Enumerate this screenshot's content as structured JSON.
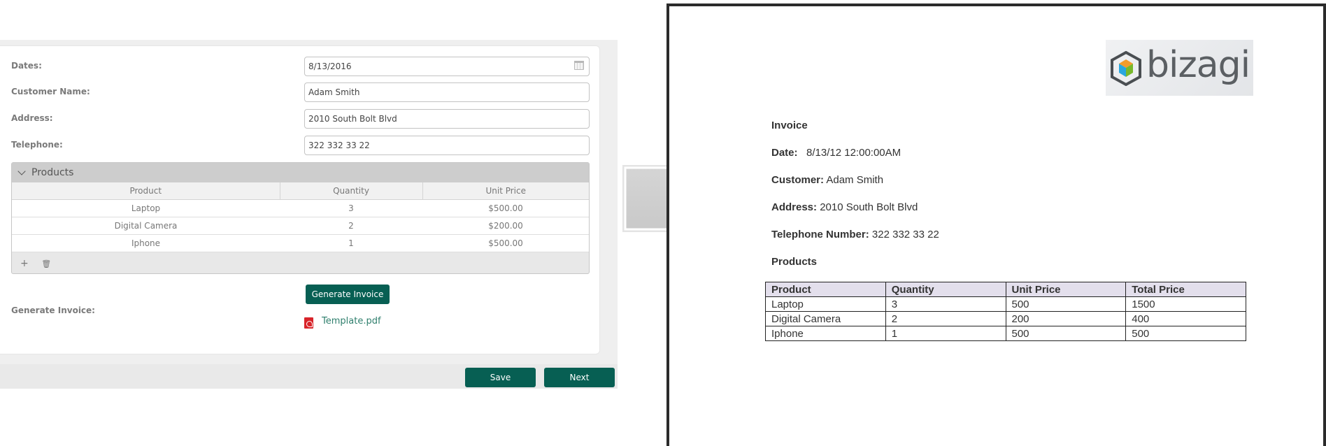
{
  "form": {
    "fields": [
      {
        "label": "Dates:",
        "value": "8/13/2016"
      },
      {
        "label": "Customer Name:",
        "value": "Adam Smith"
      },
      {
        "label": "Address:",
        "value": "2010 South Bolt Blvd"
      },
      {
        "label": "Telephone:",
        "value": "322 332 33 22"
      }
    ],
    "products": {
      "title": "Products",
      "columns": [
        "Product",
        "Quantity",
        "Unit Price"
      ],
      "rows": [
        [
          "Laptop",
          "3",
          "$500.00"
        ],
        [
          "Digital Camera",
          "2",
          "$200.00"
        ],
        [
          "Iphone",
          "1",
          "$500.00"
        ]
      ],
      "add_symbol": "+",
      "delete_symbol": "🗑"
    },
    "generate_label": "Generate Invoice:",
    "generate_button": "Generate Invoice",
    "template_link": "Template.pdf",
    "footer": {
      "save": "Save",
      "next": "Next"
    }
  },
  "invoice": {
    "logo_text": "bizagi",
    "title": "Invoice",
    "date_label": "Date:",
    "date_value": "8/13/12 12:00:00AM",
    "customer_label": "Customer:",
    "customer_value": "Adam Smith",
    "address_label": "Address:",
    "address_value": "2010 South Bolt Blvd",
    "phone_label": "Telephone Number:",
    "phone_value": "322 332 33 22",
    "products_heading": "Products",
    "table": {
      "columns": [
        "Product",
        "Quantity",
        "Unit Price",
        "Total Price"
      ],
      "rows": [
        [
          "Laptop",
          "3",
          "500",
          "1500"
        ],
        [
          "Digital Camera",
          "2",
          "200",
          "400"
        ],
        [
          "Iphone",
          "1",
          "500",
          "500"
        ]
      ]
    }
  },
  "colors": {
    "accent": "#075f53",
    "link": "#2f7f6d",
    "pdf_red": "#d8242a"
  }
}
